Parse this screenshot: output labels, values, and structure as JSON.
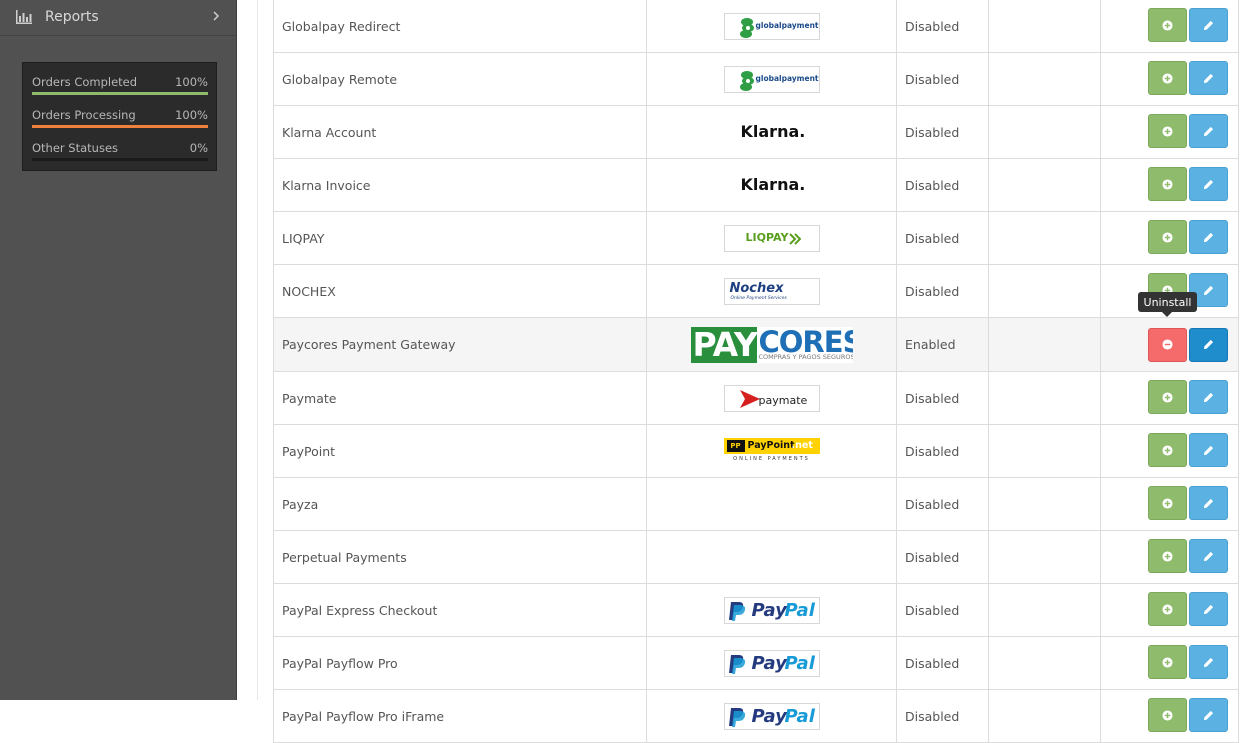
{
  "sidebar": {
    "reports": {
      "label": "Reports",
      "icon": "bar-chart-icon"
    },
    "stats": [
      {
        "label": "Orders Completed",
        "value": "100%",
        "fill": 1.0,
        "color": "#8fbb6c"
      },
      {
        "label": "Orders Processing",
        "value": "100%",
        "fill": 1.0,
        "color": "#f0803c"
      },
      {
        "label": "Other Statuses",
        "value": "0%",
        "fill": 0.0,
        "color": "#ffffff"
      }
    ]
  },
  "payments": [
    {
      "name": "Globalpay Redirect",
      "logo": "globalpayments",
      "status": "Disabled"
    },
    {
      "name": "Globalpay Remote",
      "logo": "globalpayments",
      "status": "Disabled"
    },
    {
      "name": "Klarna Account",
      "logo": "klarna",
      "status": "Disabled"
    },
    {
      "name": "Klarna Invoice",
      "logo": "klarna",
      "status": "Disabled"
    },
    {
      "name": "LIQPAY",
      "logo": "liqpay",
      "status": "Disabled"
    },
    {
      "name": "NOCHEX",
      "logo": "nochex",
      "status": "Disabled"
    },
    {
      "name": "Paycores Payment Gateway",
      "logo": "paycores",
      "status": "Enabled"
    },
    {
      "name": "Paymate",
      "logo": "paymate",
      "status": "Disabled"
    },
    {
      "name": "PayPoint",
      "logo": "paypoint",
      "status": "Disabled"
    },
    {
      "name": "Payza",
      "logo": "",
      "status": "Disabled"
    },
    {
      "name": "Perpetual Payments",
      "logo": "",
      "status": "Disabled"
    },
    {
      "name": "PayPal Express Checkout",
      "logo": "paypal",
      "status": "Disabled"
    },
    {
      "name": "PayPal Payflow Pro",
      "logo": "paypal",
      "status": "Disabled"
    },
    {
      "name": "PayPal Payflow Pro iFrame",
      "logo": "paypal",
      "status": "Disabled"
    }
  ],
  "logos": {
    "globalpayments": "globalpayments",
    "klarna": "Klarna.",
    "liqpay": "LIQPAY",
    "nochex": "Nochex",
    "nochex_sub": "Online Payment Services",
    "paycores_pay": "PAY",
    "paycores_cores": "CORES",
    "paycores_sub": "COMPRAS Y PAGOS SEGUROS",
    "paymate": "paymate",
    "paypoint": "PayPoint",
    "paypoint_net": ".net",
    "paypoint_sub": "ONLINE PAYMENTS",
    "paypal_pay": "Pay",
    "paypal_pal": "Pal"
  },
  "tooltip": "Uninstall",
  "colors": {
    "install": "#8fbb6c",
    "edit": "#5bb1e1",
    "uninstall": "#f56b6b",
    "edit_active": "#1f8ccc"
  }
}
